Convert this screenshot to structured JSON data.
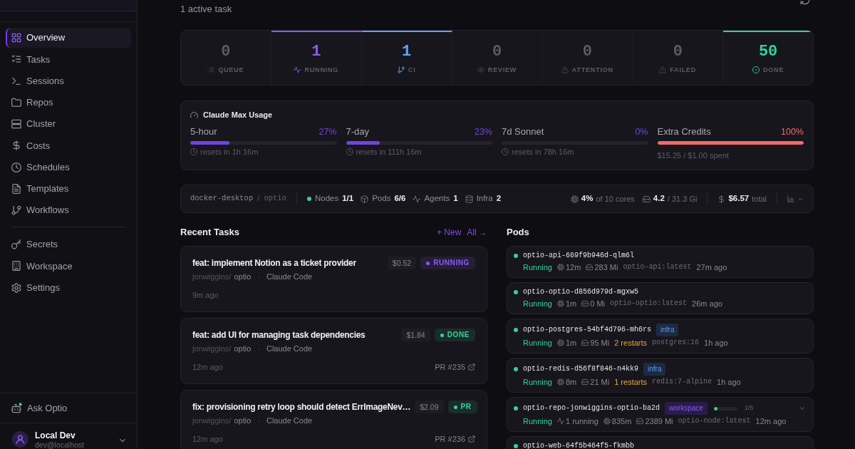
{
  "sidebar": {
    "sections": [
      {
        "items": [
          {
            "label": "Overview",
            "selected": true
          },
          {
            "label": "Tasks",
            "selected": false
          },
          {
            "label": "Sessions",
            "selected": false
          },
          {
            "label": "Repos",
            "selected": false
          },
          {
            "label": "Cluster",
            "selected": false
          },
          {
            "label": "Costs",
            "selected": false
          },
          {
            "label": "Schedules",
            "selected": false
          },
          {
            "label": "Templates",
            "selected": false
          },
          {
            "label": "Workflows",
            "selected": false
          }
        ]
      },
      {
        "items": [
          {
            "label": "Secrets",
            "selected": false
          },
          {
            "label": "Workspace",
            "selected": false
          },
          {
            "label": "Settings",
            "selected": false
          }
        ]
      }
    ],
    "assistant": {
      "label": "Ask Optio"
    },
    "user": {
      "name": "Local Dev",
      "email": "dev@localhost"
    }
  },
  "header": {
    "subtitle": "1 active task"
  },
  "stats": [
    {
      "count": "0",
      "label": "QUEUE"
    },
    {
      "count": "1",
      "label": "RUNNING",
      "color": "#8b5cf6"
    },
    {
      "count": "1",
      "label": "CI",
      "color": "#60a5fa"
    },
    {
      "count": "0",
      "label": "REVIEW"
    },
    {
      "count": "0",
      "label": "ATTENTION"
    },
    {
      "count": "0",
      "label": "FAILED"
    },
    {
      "count": "50",
      "label": "DONE",
      "color": "#34d399"
    }
  ],
  "usage": {
    "title": "Claude Max Usage",
    "meters": [
      {
        "kind": "window",
        "label": "5-hour",
        "reading": "27%",
        "level": 0.27,
        "color": "#7344e0",
        "note": "resets in 1h 16m"
      },
      {
        "kind": "window",
        "label": "7-day",
        "reading": "23%",
        "level": 0.23,
        "color": "#7344e0",
        "note": "resets in 111h 16m"
      },
      {
        "kind": "window",
        "label": "7d Sonnet",
        "reading": "0%",
        "level": 0,
        "color": "#7344e0",
        "note": "resets in 78h 16m"
      },
      {
        "kind": "credits",
        "label": "Extra Credits",
        "reading": "100%",
        "level": 1,
        "color": "#f26b6b",
        "note": "$15.25 / $1.00 spent"
      }
    ]
  },
  "cluster": {
    "context": "docker-desktop",
    "divider": "/",
    "namespace": "optio",
    "counts": [
      {
        "label": "Nodes",
        "value": "1/1"
      },
      {
        "label": "Pods",
        "value": "6/6"
      },
      {
        "label": "Agents",
        "value": "1"
      },
      {
        "label": "Infra",
        "value": "2"
      }
    ],
    "cpu": {
      "value": "4%",
      "detail": "of 10 cores"
    },
    "memory": {
      "value": "4.2",
      "detail": "/ 31.3 Gi"
    },
    "cost": {
      "value": "$6.57",
      "detail": "total"
    }
  },
  "recent_tasks": {
    "title": "Recent Tasks",
    "actions": [
      {
        "label": "+ New"
      },
      {
        "label": "All →"
      }
    ],
    "items": [
      {
        "title": "feat: implement Notion as a ticket provider",
        "cost": "$0.52",
        "status": {
          "label": "RUNNING",
          "color": "#8b5cf6"
        },
        "owner": "jonwiggins/",
        "repo": "optio",
        "separator": "·",
        "agent": "Claude Code",
        "age": "9m ago"
      },
      {
        "title": "feat: add UI for managing task dependencies",
        "cost": "$1.84",
        "status": {
          "label": "DONE",
          "color": "#34d399"
        },
        "owner": "jonwiggins/",
        "repo": "optio",
        "separator": "·",
        "agent": "Claude Code",
        "age": "12m ago",
        "pr": "PR #235"
      },
      {
        "title": "fix: provisioning retry loop should detect ErrImageNev…",
        "cost": "$2.09",
        "status": {
          "label": "PR",
          "color": "#34d399"
        },
        "owner": "jonwiggins/",
        "repo": "optio",
        "separator": "·",
        "agent": "Claude Code",
        "age": "12m ago",
        "pr": "PR #236"
      }
    ]
  },
  "pods": {
    "title": "Pods",
    "items": [
      {
        "name": "optio-api-669f9b946d-qlm6l",
        "status": "Running",
        "cpu": "12m",
        "memory": "283 Mi",
        "image": "optio-api:latest",
        "age": "27m ago"
      },
      {
        "name": "optio-optio-d856d979d-mgxw5",
        "status": "Running",
        "cpu": "1m",
        "memory": "0 Mi",
        "image": "optio-optio:latest",
        "age": "26m ago"
      },
      {
        "name": "optio-postgres-54bf4d796-mh6rs",
        "tag": {
          "label": "infra",
          "color": "#1c2b44"
        },
        "status": "Running",
        "cpu": "1m",
        "memory": "95 Mi",
        "restarts": "2 restarts",
        "image": "postgres:16",
        "age": "1h ago"
      },
      {
        "name": "optio-redis-d56f8f846-n4kk9",
        "tag": {
          "label": "infra",
          "color": "#1c2b44"
        },
        "status": "Running",
        "cpu": "8m",
        "memory": "21 Mi",
        "restarts": "1 restarts",
        "image": "redis:7-alpine",
        "age": "1h ago"
      },
      {
        "name": "optio-repo-jonwiggins-optio-ba2d",
        "tag": {
          "label": "workspace",
          "color": "#2a1c4a"
        },
        "progress": {
          "level": 0.17,
          "reading": "1/6"
        },
        "expanded": false,
        "status": "Running",
        "agents": "1 running",
        "cpu": "835m",
        "memory": "2389 Mi",
        "image": "optio-node:latest",
        "age": "12m ago"
      },
      {
        "name": "optio-web-64f5b464f5-fkmbb"
      }
    ]
  }
}
